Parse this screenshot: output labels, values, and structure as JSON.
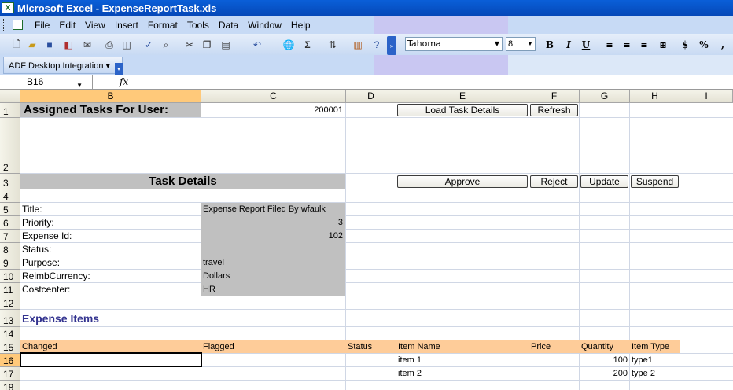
{
  "window": {
    "title": "Microsoft Excel - ExpenseReportTask.xls"
  },
  "menu": [
    {
      "label": "File"
    },
    {
      "label": "Edit"
    },
    {
      "label": "View"
    },
    {
      "label": "Insert"
    },
    {
      "label": "Format"
    },
    {
      "label": "Tools"
    },
    {
      "label": "Data"
    },
    {
      "label": "Window"
    },
    {
      "label": "Help"
    }
  ],
  "toolbar": {
    "font": "Tahoma",
    "font_size": "8",
    "bold": "B",
    "italic": "I",
    "underline": "U",
    "currency": "$",
    "percent": "%",
    "comma": ","
  },
  "adf": {
    "label": "ADF Desktop Integration ▾"
  },
  "formula_bar": {
    "name_box": "B16",
    "fx": "fx",
    "value": ""
  },
  "columns": [
    "B",
    "C",
    "D",
    "E",
    "F",
    "G",
    "H",
    "I"
  ],
  "rows": [
    "1",
    "2",
    "3",
    "4",
    "5",
    "6",
    "7",
    "8",
    "9",
    "10",
    "11",
    "12",
    "13",
    "14",
    "15",
    "16",
    "17",
    "18"
  ],
  "sheet": {
    "assigned_title": "Assigned Tasks For User:",
    "user_id": "200001",
    "load_button": "Load Task Details",
    "refresh_button": "Refresh",
    "task_details_title": "Task Details",
    "approve_button": "Approve",
    "reject_button": "Reject",
    "update_button": "Update",
    "suspend_button": "Suspend",
    "fields": [
      {
        "label": "Title:",
        "value": "Expense Report Filed By wfaulk",
        "align": "left"
      },
      {
        "label": "Priority:",
        "value": "3",
        "align": "right"
      },
      {
        "label": "Expense Id:",
        "value": "102",
        "align": "right"
      },
      {
        "label": "Status:",
        "value": "",
        "align": "left"
      },
      {
        "label": "Purpose:",
        "value": "travel",
        "align": "left"
      },
      {
        "label": "ReimbCurrency:",
        "value": "Dollars",
        "align": "left"
      },
      {
        "label": "Costcenter:",
        "value": "HR",
        "align": "left"
      }
    ],
    "expense_items_title": "Expense Items",
    "table_headers": {
      "changed": "Changed",
      "flagged": "Flagged",
      "status": "Status",
      "item_name": "Item Name",
      "price": "Price",
      "quantity": "Quantity",
      "item_type": "Item Type"
    },
    "items": [
      {
        "item_name": "item 1",
        "quantity": "100",
        "item_type": "type1"
      },
      {
        "item_name": "item 2",
        "quantity": "200",
        "item_type": "type 2"
      }
    ]
  }
}
